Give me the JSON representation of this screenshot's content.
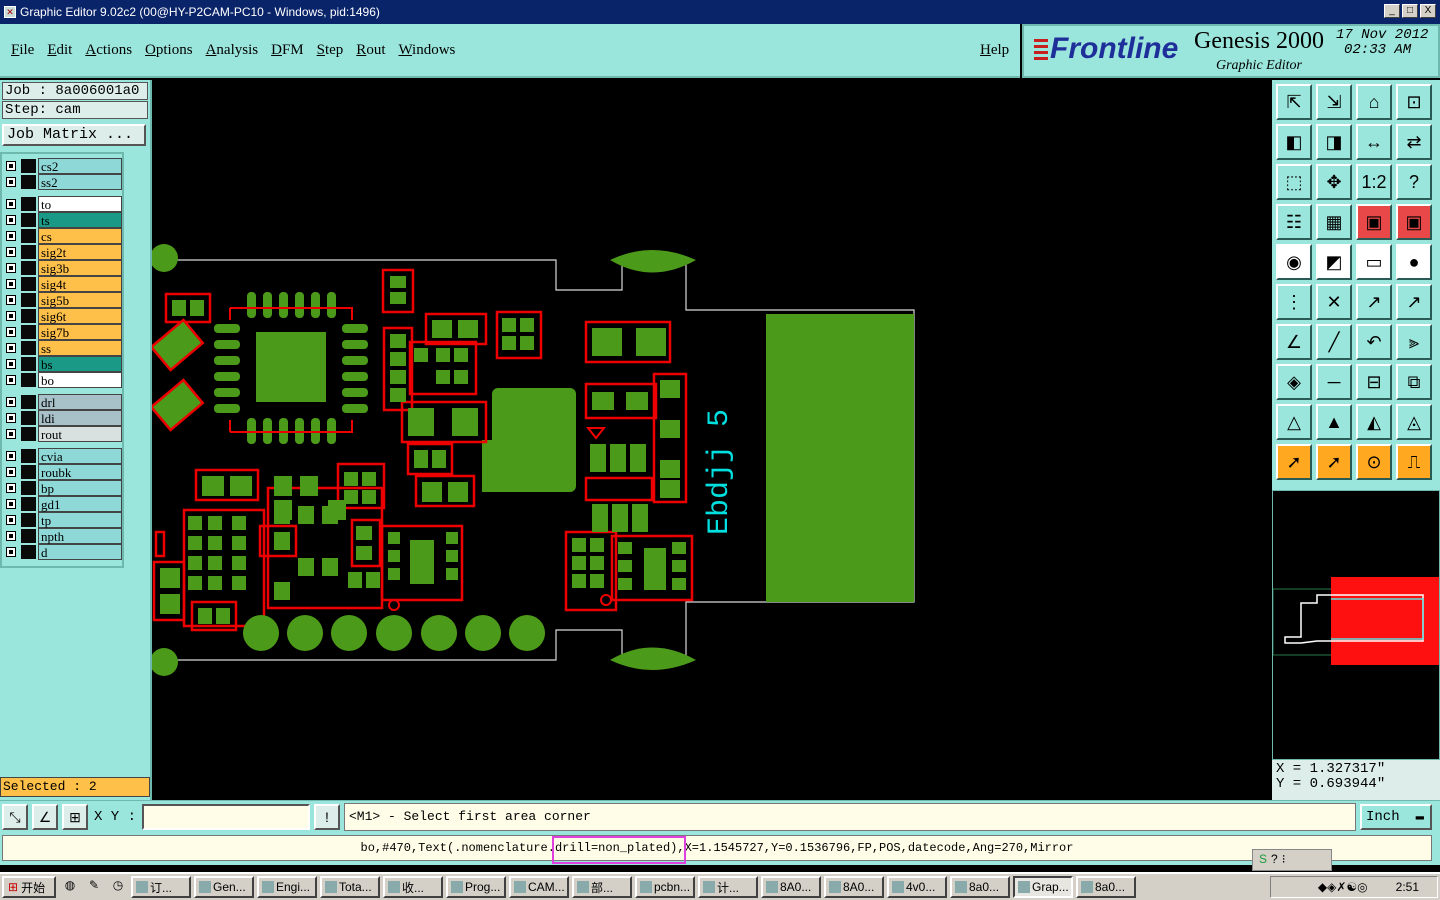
{
  "window": {
    "title": "Graphic Editor 9.02c2 (00@HY-P2CAM-PC10 - Windows, pid:1496)",
    "controls": [
      "_",
      "□",
      "X"
    ]
  },
  "menu": {
    "items": [
      "File",
      "Edit",
      "Actions",
      "Options",
      "Analysis",
      "DFM",
      "Step",
      "Rout",
      "Windows"
    ],
    "help": "Help"
  },
  "brand": {
    "logo": "Frontline",
    "product": "Genesis 2000",
    "subtitle": "Graphic Editor",
    "date": "17 Nov 2012",
    "time": "02:33 AM"
  },
  "job": {
    "job_label": "Job : 8a006001a0",
    "step_label": "Step: cam",
    "job_matrix": "Job Matrix ..."
  },
  "layers": [
    {
      "name": "cs2",
      "color": "#8ed8d8"
    },
    {
      "name": "ss2",
      "color": "#8ed8d8"
    },
    {
      "name": "to",
      "color": "#ffffff"
    },
    {
      "name": "ts",
      "color": "#1a9a86"
    },
    {
      "name": "cs",
      "color": "#ffc04a"
    },
    {
      "name": "sig2t",
      "color": "#ffc04a"
    },
    {
      "name": "sig3b",
      "color": "#ffc04a"
    },
    {
      "name": "sig4t",
      "color": "#ffc04a"
    },
    {
      "name": "sig5b",
      "color": "#ffc04a"
    },
    {
      "name": "sig6t",
      "color": "#ffc04a"
    },
    {
      "name": "sig7b",
      "color": "#ffc04a"
    },
    {
      "name": "ss",
      "color": "#ffc04a"
    },
    {
      "name": "bs",
      "color": "#1a9a86"
    },
    {
      "name": "bo",
      "color": "#ffffff"
    },
    {
      "name": "drl",
      "color": "#a8c0c8"
    },
    {
      "name": "ldi",
      "color": "#a8c0c8"
    },
    {
      "name": "rout",
      "color": "#d8e0e0"
    },
    {
      "name": "cvia",
      "color": "#8ed8d8"
    },
    {
      "name": "roubk",
      "color": "#8ed8d8"
    },
    {
      "name": "bp",
      "color": "#8ed8d8"
    },
    {
      "name": "gd1",
      "color": "#8ed8d8"
    },
    {
      "name": "tp",
      "color": "#8ed8d8"
    },
    {
      "name": "npth",
      "color": "#8ed8d8"
    },
    {
      "name": "d",
      "color": "#8ed8d8"
    }
  ],
  "selected": "Selected : 2",
  "canvas": {
    "silkscreen_text": "Ebdjj 5"
  },
  "coords": {
    "x": "X = 1.327317\"",
    "y": "Y = 0.693944\""
  },
  "command": {
    "xy_label": "X Y :",
    "xy_value": "",
    "prompt": "<M1> - Select first area corner",
    "unit": "Inch"
  },
  "status": {
    "before": "bo,#470,Text(.nomenclature",
    "highlight": ".drill=non_plated)",
    "after": ",X=1.1545727,Y=0.1536796,FP,POS,datecode,Ang=270,Mirror"
  },
  "taskbar": {
    "start": "开始",
    "tasks": [
      "订...",
      "Gen...",
      "Engi...",
      "Tota...",
      "收...",
      "Prog...",
      "CAM...",
      "部...",
      "pcbn...",
      "计...",
      "8A0...",
      "8A0...",
      "4v0...",
      "8a0...",
      "Grap...",
      "8a0..."
    ],
    "clock": "2:51"
  }
}
